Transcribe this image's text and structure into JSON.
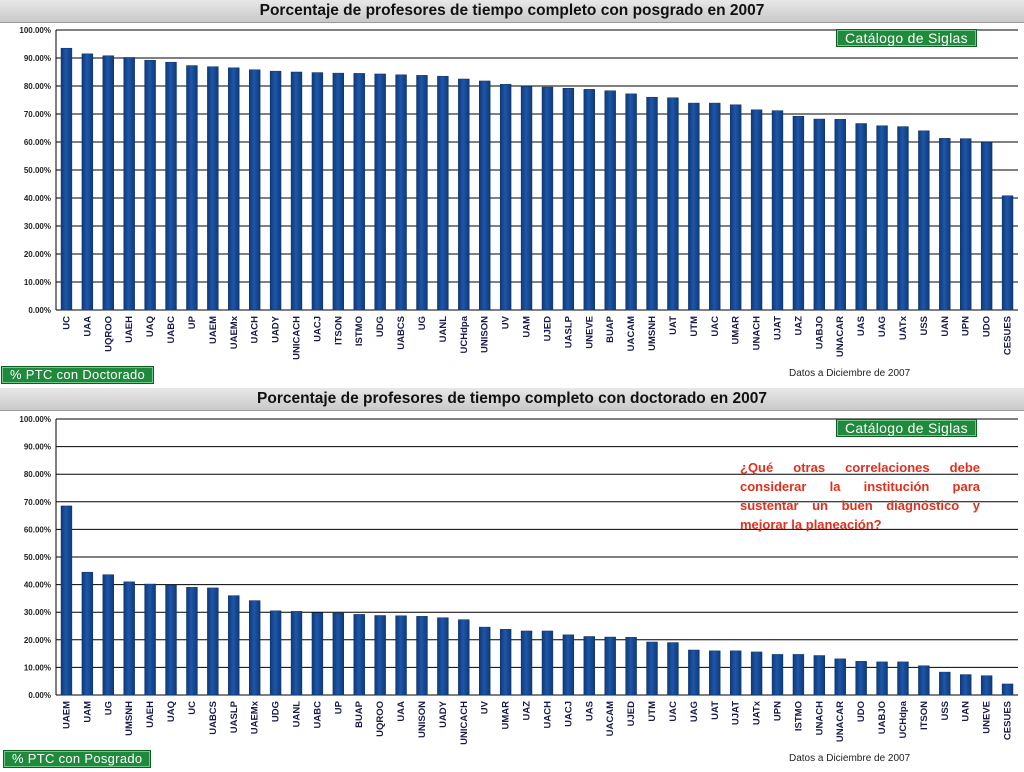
{
  "chart_data": [
    {
      "type": "bar",
      "title": "Porcentaje de profesores de tiempo completo con posgrado en 2007",
      "categories": [
        "UC",
        "UAA",
        "UQROO",
        "UAEH",
        "UAQ",
        "UABC",
        "UP",
        "UAEM",
        "UAEMx",
        "UACH",
        "UADY",
        "UNICACH",
        "UACJ",
        "ITSON",
        "ISTMO",
        "UDG",
        "UABCS",
        "UG",
        "UANL",
        "UCHdpa",
        "UNISON",
        "UV",
        "UAM",
        "UJED",
        "UASLP",
        "UNEVE",
        "BUAP",
        "UACAM",
        "UMSNH",
        "UAT",
        "UTM",
        "UAC",
        "UMAR",
        "UNACH",
        "UJAT",
        "UAZ",
        "UABJO",
        "UNACAR",
        "UAS",
        "UAG",
        "UATx",
        "USS",
        "UAN",
        "UPN",
        "UDO",
        "CESUES"
      ],
      "values": [
        93.5,
        91.5,
        90.8,
        90.2,
        89.2,
        88.5,
        87.3,
        86.9,
        86.5,
        85.8,
        85.3,
        85.0,
        84.8,
        84.6,
        84.5,
        84.3,
        84.0,
        83.8,
        83.5,
        82.5,
        81.8,
        80.6,
        79.9,
        79.6,
        79.2,
        78.8,
        78.3,
        77.2,
        76.0,
        75.8,
        73.9,
        73.9,
        73.3,
        71.5,
        71.2,
        69.2,
        68.2,
        68.1,
        66.6,
        65.8,
        65.5,
        64.0,
        61.3,
        61.2,
        59.9,
        40.8
      ],
      "xlabel": "",
      "ylabel": "",
      "ylim": [
        0,
        100
      ],
      "yticks": [
        "0.00%",
        "10.00%",
        "20.00%",
        "30.00%",
        "40.00%",
        "50.00%",
        "60.00%",
        "70.00%",
        "80.00%",
        "90.00%",
        "100.00%"
      ],
      "grid": true
    },
    {
      "type": "bar",
      "title": "Porcentaje de profesores de tiempo completo con doctorado en 2007",
      "categories": [
        "UAEM",
        "UAM",
        "UG",
        "UMSNH",
        "UAEH",
        "UAQ",
        "UC",
        "UABCS",
        "UASLP",
        "UAEMx",
        "UDG",
        "UANL",
        "UABC",
        "UP",
        "BUAP",
        "UQROO",
        "UAA",
        "UNISON",
        "UADY",
        "UNICACH",
        "UV",
        "UMAR",
        "UAZ",
        "UACH",
        "UACJ",
        "UAS",
        "UACAM",
        "UJED",
        "UTM",
        "UAC",
        "UAG",
        "UAT",
        "UJAT",
        "UATx",
        "UPN",
        "ISTMO",
        "UNACH",
        "UNACAR",
        "UDO",
        "UABJO",
        "UCHdpa",
        "ITSON",
        "USS",
        "UAN",
        "UNEVE",
        "CESUES"
      ],
      "values": [
        68.5,
        44.5,
        43.6,
        41.0,
        40.2,
        39.8,
        39.0,
        38.8,
        36.0,
        34.2,
        30.5,
        30.3,
        29.8,
        29.7,
        29.2,
        28.8,
        28.7,
        28.5,
        28.0,
        27.3,
        24.6,
        23.8,
        23.2,
        23.2,
        21.8,
        21.2,
        21.0,
        20.9,
        19.2,
        19.0,
        16.3,
        16.0,
        16.0,
        15.6,
        14.7,
        14.7,
        14.3,
        13.1,
        12.2,
        12.0,
        12.0,
        10.6,
        8.3,
        7.4,
        7.0,
        4.0
      ],
      "xlabel": "",
      "ylabel": "",
      "ylim": [
        0,
        100
      ],
      "yticks": [
        "0.00%",
        "10.00%",
        "20.00%",
        "30.00%",
        "40.00%",
        "50.00%",
        "60.00%",
        "70.00%",
        "80.00%",
        "90.00%",
        "100.00%"
      ],
      "grid": true
    }
  ],
  "top_panel": {
    "title": "Porcentaje de profesores de tiempo completo con posgrado en 2007",
    "catalog_button": "Catálogo de Siglas",
    "switch_button": "% PTC con Doctorado",
    "footnote": "Datos a Diciembre de 2007"
  },
  "bottom_panel": {
    "title": "Porcentaje de profesores de tiempo completo con doctorado en 2007",
    "catalog_button": "Catálogo de Siglas",
    "switch_button": "% PTC con Posgrado",
    "footnote": "Datos a Diciembre de 2007",
    "question": "¿Qué otras correlaciones debe considerar la institución para sustentar un buen diagnóstico y mejorar la planeación?"
  },
  "colors": {
    "bar": "#1f56a8",
    "bar_dark": "#0d3a7a",
    "button": "#1f8a3c",
    "question": "#e0301e"
  }
}
